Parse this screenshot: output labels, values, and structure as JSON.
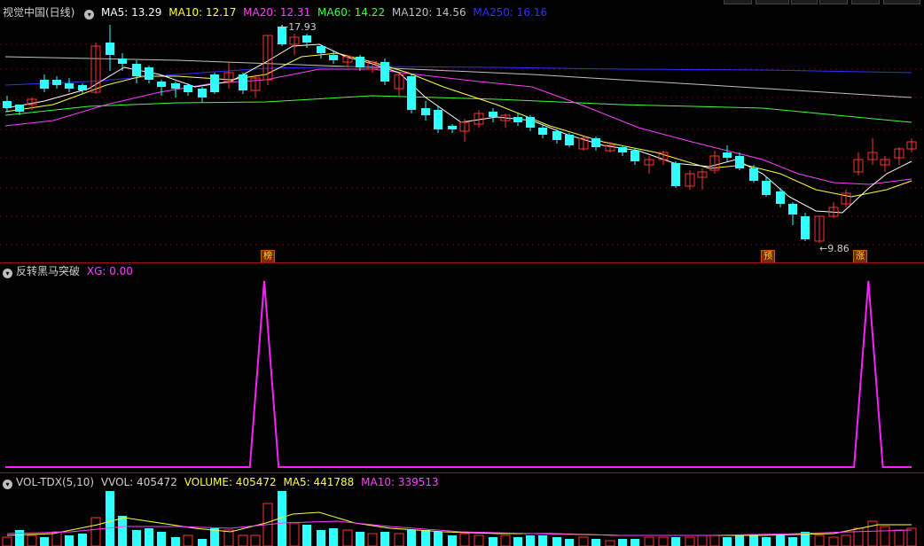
{
  "main": {
    "title": "视觉中国(日线)",
    "ma5": "MA5: 13.29",
    "ma10": "MA10: 12.17",
    "ma20": "MA20: 12.31",
    "ma60": "MA60: 14.22",
    "ma120": "MA120: 14.56",
    "ma250": "MA250: 16.16",
    "colors": {
      "ma5": "#ffffff",
      "ma10": "#ffff40",
      "ma20": "#ff40ff",
      "ma60": "#40ff40",
      "ma120": "#c0c0c0",
      "ma250": "#3030ff",
      "up": "#ff3333",
      "down": "#30ffff"
    },
    "high_label": "17.93",
    "low_label": "9.86",
    "badges": [
      "榜",
      "预",
      "涨"
    ]
  },
  "indicator": {
    "title": "反转黑马突破",
    "xg": "XG: 0.00",
    "color": "#ff20ff"
  },
  "volume": {
    "title": "VOL-TDX(5,10)",
    "vvol": "VVOL: 405472",
    "volume": "VOLUME: 405472",
    "ma5": "MA5: 441788",
    "ma10": "MA10: 339513"
  },
  "chart_data": {
    "type": "line",
    "series": [
      {
        "name": "XG",
        "values": [
          0,
          0,
          0,
          0,
          0,
          0,
          0,
          0,
          0,
          0,
          0,
          0,
          0,
          0,
          0,
          0,
          0,
          0,
          1,
          0,
          0,
          0,
          0,
          0,
          0,
          0,
          0,
          0,
          0,
          0,
          0,
          0,
          0,
          0,
          0,
          0,
          0,
          0,
          0,
          0,
          0,
          0,
          0,
          0,
          0,
          0,
          0,
          0,
          0,
          0,
          0,
          0,
          0,
          0,
          0,
          0,
          0,
          0,
          0,
          0,
          1,
          0,
          0,
          0
        ]
      }
    ]
  }
}
